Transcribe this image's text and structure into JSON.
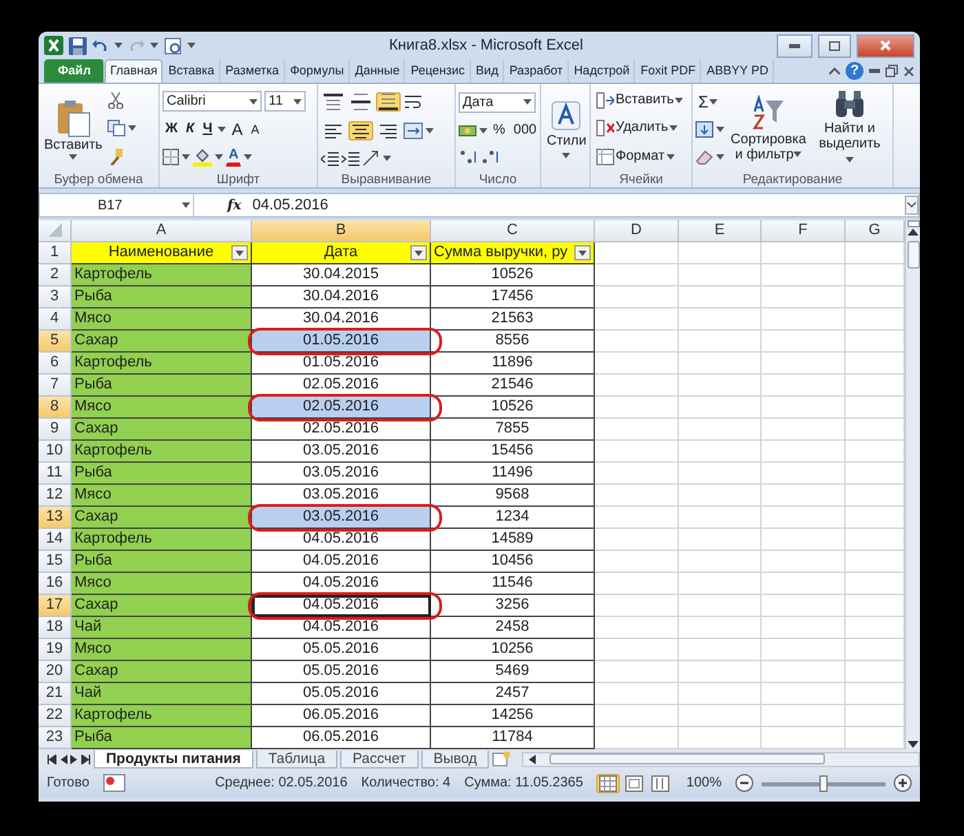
{
  "window": {
    "title": "Книга8.xlsx - Microsoft Excel"
  },
  "tabs": [
    {
      "label": "Файл",
      "kind": "file",
      "selected": false
    },
    {
      "label": "Главная",
      "kind": "tab",
      "selected": true
    },
    {
      "label": "Вставка",
      "kind": "tab",
      "selected": false
    },
    {
      "label": "Разметка",
      "kind": "tab",
      "selected": false
    },
    {
      "label": "Формулы",
      "kind": "tab",
      "selected": false
    },
    {
      "label": "Данные",
      "kind": "tab",
      "selected": false
    },
    {
      "label": "Рецензис",
      "kind": "tab",
      "selected": false
    },
    {
      "label": "Вид",
      "kind": "tab",
      "selected": false
    },
    {
      "label": "Разработ",
      "kind": "tab",
      "selected": false
    },
    {
      "label": "Надстрой",
      "kind": "tab",
      "selected": false
    },
    {
      "label": "Foxit PDF",
      "kind": "tab",
      "selected": false
    },
    {
      "label": "ABBYY PD",
      "kind": "tab",
      "selected": false
    }
  ],
  "help_label": "?",
  "ribbon_groups": [
    {
      "kind": "clipboard",
      "label": "Буфер обмена",
      "paste": "Вставить"
    },
    {
      "kind": "font",
      "label": "Шрифт",
      "font": "Calibri",
      "size": "11",
      "bold": "Ж",
      "italic": "К",
      "underline": "Ч",
      "grow": "A",
      "shrink": "A",
      "font_color": "A"
    },
    {
      "kind": "alignment",
      "label": "Выравнивание",
      "vertical": [
        {
          "selected": false
        },
        {
          "selected": false
        },
        {
          "selected": true
        }
      ],
      "horizontal": [
        {
          "selected": false
        },
        {
          "selected": true
        },
        {
          "selected": false
        }
      ]
    },
    {
      "kind": "number",
      "label": "Число",
      "format": "Дата",
      "percent": "%",
      "thousands": "000"
    },
    {
      "kind": "styles",
      "button": "Стили"
    },
    {
      "kind": "cells",
      "label": "Ячейки",
      "buttons": [
        "Вставить",
        "Удалить",
        "Формат"
      ]
    },
    {
      "kind": "editing",
      "label": "Редактирование",
      "sum": "Σ",
      "sort": "Сортировка и фильтр",
      "find": "Найти и выделить"
    }
  ],
  "formula_bar": {
    "name_box": "B17",
    "fx": "fx",
    "value": "04.05.2016"
  },
  "columns": [
    {
      "letter": "A",
      "selected": false
    },
    {
      "letter": "B",
      "selected": true
    },
    {
      "letter": "C",
      "selected": false
    },
    {
      "letter": "D",
      "selected": false
    },
    {
      "letter": "E",
      "selected": false
    },
    {
      "letter": "F",
      "selected": false
    },
    {
      "letter": "G",
      "selected": false
    }
  ],
  "header_row": {
    "number": "1",
    "cells": [
      "Наименование",
      "Дата",
      "Сумма выручки, ру"
    ]
  },
  "rows": [
    {
      "number": "2",
      "name": "Картофель",
      "date": "30.04.2015",
      "sum": "10526",
      "selected": false,
      "active": false,
      "circled": false
    },
    {
      "number": "3",
      "name": "Рыба",
      "date": "30.04.2016",
      "sum": "17456",
      "selected": false,
      "active": false,
      "circled": false
    },
    {
      "number": "4",
      "name": "Мясо",
      "date": "30.04.2016",
      "sum": "21563",
      "selected": false,
      "active": false,
      "circled": false
    },
    {
      "number": "5",
      "name": "Сахар",
      "date": "01.05.2016",
      "sum": "8556",
      "selected": true,
      "active": false,
      "circled": true
    },
    {
      "number": "6",
      "name": "Картофель",
      "date": "01.05.2016",
      "sum": "11896",
      "selected": false,
      "active": false,
      "circled": false
    },
    {
      "number": "7",
      "name": "Рыба",
      "date": "02.05.2016",
      "sum": "21546",
      "selected": false,
      "active": false,
      "circled": false
    },
    {
      "number": "8",
      "name": "Мясо",
      "date": "02.05.2016",
      "sum": "10526",
      "selected": true,
      "active": false,
      "circled": true
    },
    {
      "number": "9",
      "name": "Сахар",
      "date": "02.05.2016",
      "sum": "7855",
      "selected": false,
      "active": false,
      "circled": false
    },
    {
      "number": "10",
      "name": "Картофель",
      "date": "03.05.2016",
      "sum": "15456",
      "selected": false,
      "active": false,
      "circled": false
    },
    {
      "number": "11",
      "name": "Рыба",
      "date": "03.05.2016",
      "sum": "11496",
      "selected": false,
      "active": false,
      "circled": false
    },
    {
      "number": "12",
      "name": "Мясо",
      "date": "03.05.2016",
      "sum": "9568",
      "selected": false,
      "active": false,
      "circled": false
    },
    {
      "number": "13",
      "name": "Сахар",
      "date": "03.05.2016",
      "sum": "1234",
      "selected": true,
      "active": false,
      "circled": true
    },
    {
      "number": "14",
      "name": "Картофель",
      "date": "04.05.2016",
      "sum": "14589",
      "selected": false,
      "active": false,
      "circled": false
    },
    {
      "number": "15",
      "name": "Рыба",
      "date": "04.05.2016",
      "sum": "10456",
      "selected": false,
      "active": false,
      "circled": false
    },
    {
      "number": "16",
      "name": "Мясо",
      "date": "04.05.2016",
      "sum": "11546",
      "selected": false,
      "active": false,
      "circled": false
    },
    {
      "number": "17",
      "name": "Сахар",
      "date": "04.05.2016",
      "sum": "3256",
      "selected": true,
      "active": true,
      "circled": true
    },
    {
      "number": "18",
      "name": "Чай",
      "date": "04.05.2016",
      "sum": "2458",
      "selected": false,
      "active": false,
      "circled": false
    },
    {
      "number": "19",
      "name": "Мясо",
      "date": "05.05.2016",
      "sum": "10256",
      "selected": false,
      "active": false,
      "circled": false
    },
    {
      "number": "20",
      "name": "Сахар",
      "date": "05.05.2016",
      "sum": "5469",
      "selected": false,
      "active": false,
      "circled": false
    },
    {
      "number": "21",
      "name": "Чай",
      "date": "05.05.2016",
      "sum": "2457",
      "selected": false,
      "active": false,
      "circled": false
    },
    {
      "number": "22",
      "name": "Картофель",
      "date": "06.05.2016",
      "sum": "14256",
      "selected": false,
      "active": false,
      "circled": false
    },
    {
      "number": "23",
      "name": "Рыба",
      "date": "06.05.2016",
      "sum": "11784",
      "selected": false,
      "active": false,
      "circled": false
    }
  ],
  "sheets": [
    {
      "label": "Продукты питания",
      "selected": true
    },
    {
      "label": "Таблица",
      "selected": false
    },
    {
      "label": "Рассчет",
      "selected": false
    },
    {
      "label": "Вывод",
      "selected": false
    }
  ],
  "status_bar": {
    "state": "Готово",
    "average": "Среднее: 02.05.2016",
    "count": "Количество: 4",
    "sum": "Сумма: 11.05.2365",
    "views": [
      {
        "kind": "normal",
        "selected": true
      },
      {
        "kind": "layout",
        "selected": false
      },
      {
        "kind": "pagebreak",
        "selected": false
      }
    ],
    "zoom": "100%",
    "zoom_slider": {
      "level": 0.5
    }
  }
}
